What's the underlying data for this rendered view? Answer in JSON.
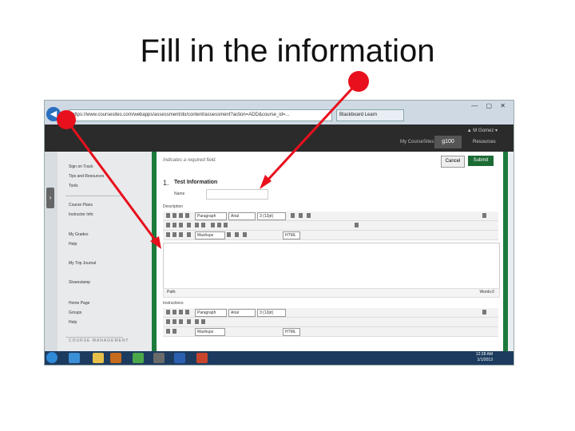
{
  "slide": {
    "title": "Fill in the information"
  },
  "browser": {
    "address": "https://www.coursesites.com/webapps/assessment/do/content/assessment?action=ADD&course_id=...",
    "tab_title": "Blackboard Learn",
    "window_buttons": "— ▢ ✕"
  },
  "site": {
    "user": "▲ M Gomez ▾",
    "nav": {
      "my_coursesites": "My CourseSites",
      "course": "g100",
      "resources": "Resources"
    }
  },
  "sidebar": {
    "items": [
      {
        "label": "Sign on Track"
      },
      {
        "label": "Tips and Resources"
      },
      {
        "label": "Tools"
      },
      {
        "label": "Course Plans"
      },
      {
        "label": "Instructor Info"
      },
      {
        "label": "My Grades"
      },
      {
        "label": "Help"
      },
      {
        "label": "My Trip Journal"
      },
      {
        "label": "Sharestamp"
      },
      {
        "label": "Home Page"
      },
      {
        "label": "Groups"
      },
      {
        "label": "Help"
      }
    ],
    "footer": "COURSE MANAGEMENT"
  },
  "form": {
    "required_note": "Indicates a required field.",
    "cancel_label": "Cancel",
    "submit_label": "Submit",
    "section_number": "1.",
    "section_title": "Test Information",
    "name_label": "Name",
    "description_label": "Description",
    "instructions_label": "Instructions",
    "toolbar": {
      "format": "Paragraph",
      "font": "Arial",
      "size": "3 (12pt)",
      "mashups": "Mashups",
      "html": "HTML"
    },
    "path_label": "Path:",
    "words_label": "Words:0"
  },
  "taskbar": {
    "time": "12:28 AM",
    "date": "1/1/2013"
  },
  "annotation_color": "#e8101c"
}
